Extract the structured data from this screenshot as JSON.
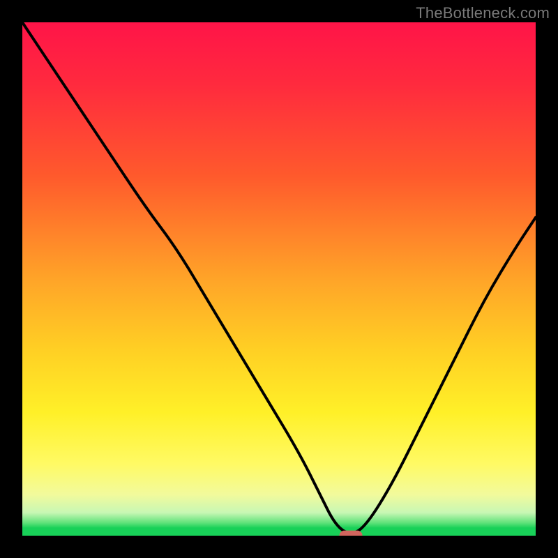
{
  "watermark": "TheBottleneck.com",
  "colors": {
    "frame": "#000000",
    "curve": "#000000",
    "marker": "#d2655e",
    "gradient_top": "#ff1448",
    "gradient_bottom": "#18d158"
  },
  "chart_data": {
    "type": "line",
    "title": "",
    "xlabel": "",
    "ylabel": "",
    "xlim": [
      0,
      100
    ],
    "ylim": [
      0,
      100
    ],
    "grid": false,
    "legend": false,
    "notes": "V-shaped bottleneck curve. Y=0 (bottom, green) is best / least bottleneck; Y=100 (top, red) is worst. The minimum sits around x≈62–66; the rounded red marker sits on the baseline at the minimum.",
    "series": [
      {
        "name": "bottleneck-curve",
        "x": [
          0,
          8,
          16,
          24,
          30,
          36,
          42,
          48,
          54,
          58,
          61,
          64,
          67,
          72,
          78,
          84,
          90,
          96,
          100
        ],
        "y": [
          100,
          88,
          76,
          64,
          56,
          46,
          36,
          26,
          16,
          8,
          2,
          0,
          2,
          10,
          22,
          34,
          46,
          56,
          62
        ]
      }
    ],
    "marker": {
      "x": 64,
      "y": 0,
      "width_pct": 4.5,
      "height_pct": 2
    }
  }
}
